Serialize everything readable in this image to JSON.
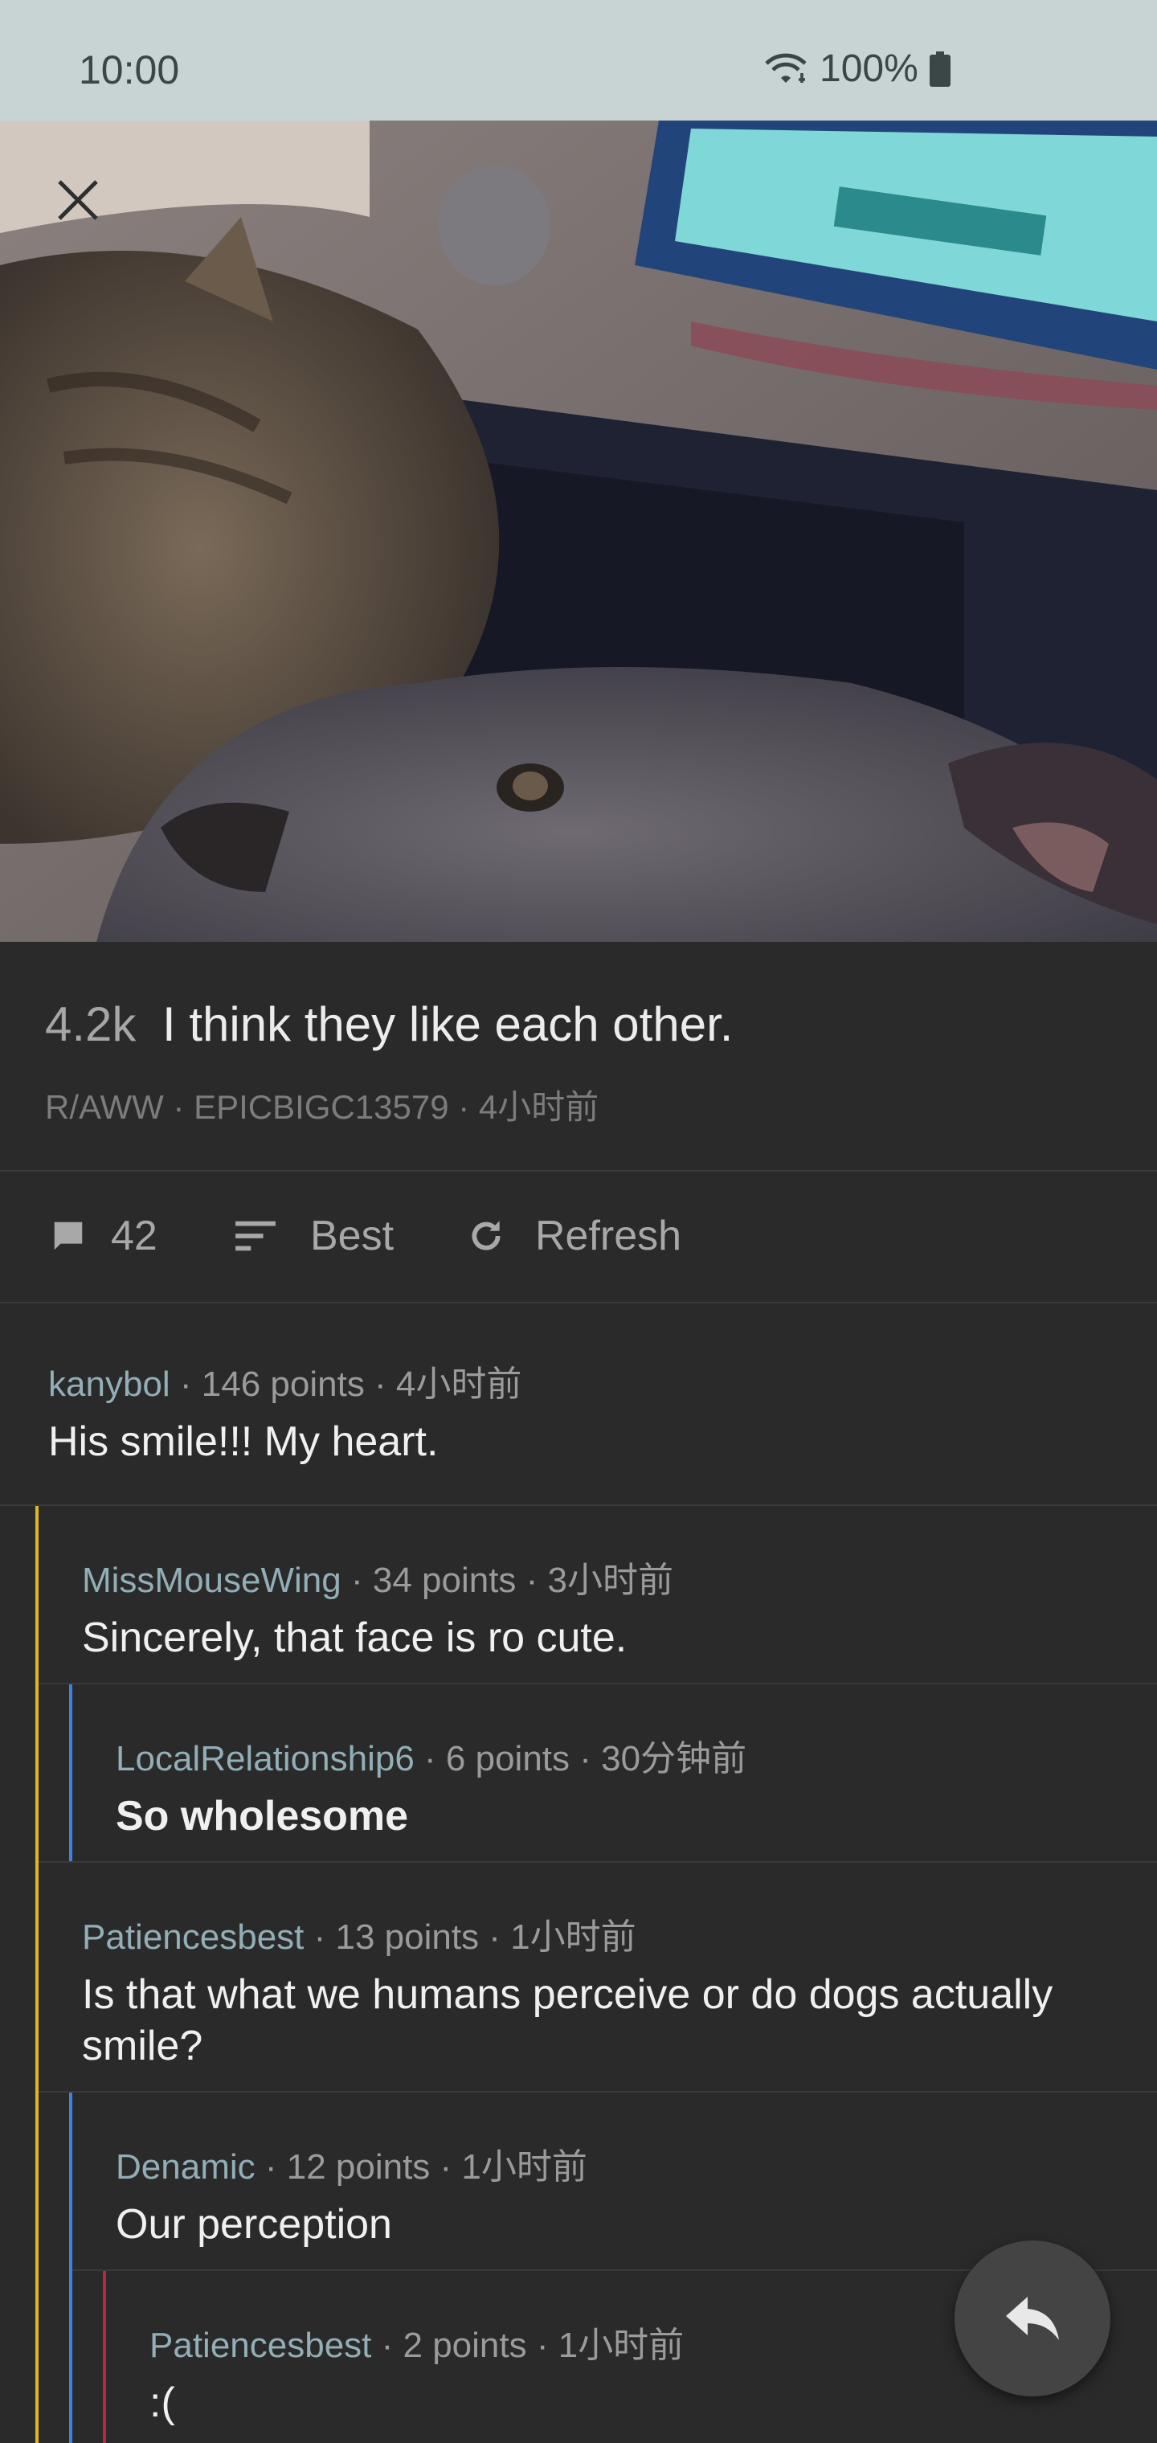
{
  "status_bar": {
    "time": "10:00",
    "battery": "100%"
  },
  "post": {
    "score": "4.2k",
    "title": "I think they like each other.",
    "meta": "R/AWW · EPICBIGC13579 · 4小时前"
  },
  "actions": {
    "comments_count": "42",
    "sort_label": "Best",
    "refresh_label": "Refresh"
  },
  "comments": [
    {
      "author": "kanybol",
      "info": " · 146 points · 4小时前",
      "text": "His smile!!! My heart."
    },
    {
      "author": "MissMouseWing",
      "info": " · 34 points · 3小时前",
      "text": "Sincerely, that face is ro cute."
    },
    {
      "author": "LocalRelationship6",
      "info": " · 6 points · 30分钟前",
      "text": "So wholesome"
    },
    {
      "author": "Patiencesbest",
      "info": " · 13 points · 1小时前",
      "text": "Is that what we humans perceive or do dogs actually smile?"
    },
    {
      "author": "Denamic",
      "info": " · 12 points · 1小时前",
      "text": "Our perception"
    },
    {
      "author": "Patiencesbest",
      "info": " · 2 points · 1小时前",
      "text": ":("
    }
  ],
  "colors": {
    "thread_level_1": "#e3b32a",
    "thread_level_2": "#3b82e6",
    "thread_level_3": "#c2253a"
  },
  "icons": [
    "close-icon",
    "wifi-icon",
    "battery-icon",
    "comment-icon",
    "sort-icon",
    "refresh-icon",
    "reply-icon"
  ]
}
